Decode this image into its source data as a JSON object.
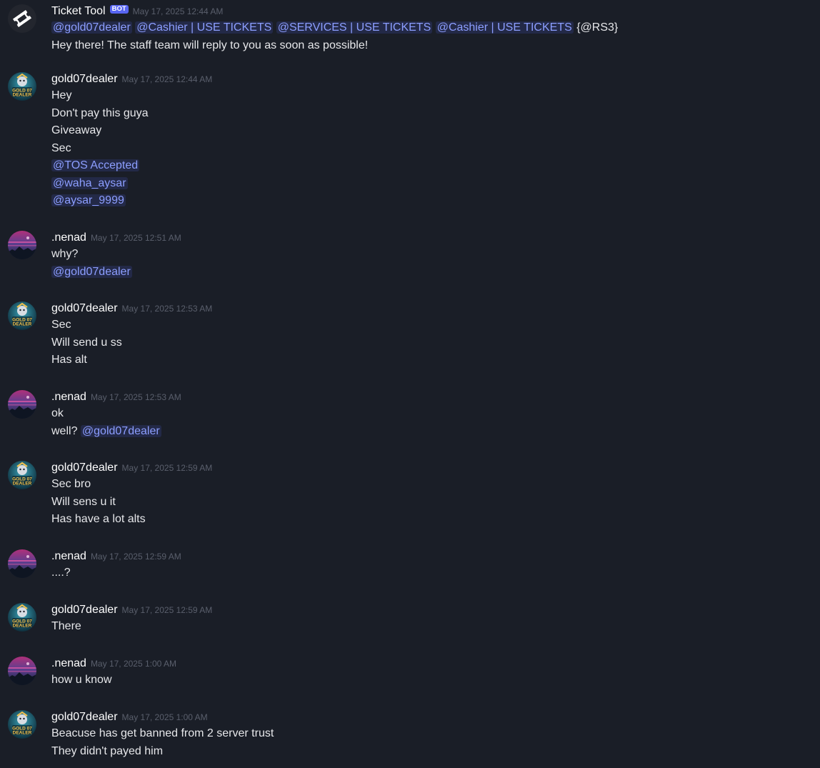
{
  "messages": [
    {
      "kind": "bot",
      "author": "Ticket Tool",
      "bot_tag": "BOT",
      "timestamp": "May 17, 2025 12:44 AM",
      "lines": [
        [
          {
            "type": "mention",
            "text": "@gold07dealer"
          },
          {
            "type": "text",
            "text": " "
          },
          {
            "type": "mention",
            "text": "@Cashier | USE TICKETS"
          },
          {
            "type": "text",
            "text": " "
          },
          {
            "type": "mention",
            "text": "@SERVICES | USE TICKETS"
          },
          {
            "type": "text",
            "text": " "
          },
          {
            "type": "mention",
            "text": "@Cashier | USE TICKETS"
          },
          {
            "type": "text",
            "text": " {@RS3}"
          }
        ],
        [
          {
            "type": "text",
            "text": "Hey there! The staff team will reply to you as soon as possible!"
          }
        ]
      ]
    },
    {
      "kind": "gold",
      "author": "gold07dealer",
      "timestamp": "May 17, 2025 12:44 AM",
      "lines": [
        [
          {
            "type": "text",
            "text": "Hey"
          }
        ],
        [
          {
            "type": "text",
            "text": "Don't pay this guya"
          }
        ],
        [
          {
            "type": "text",
            "text": "Giveaway"
          }
        ],
        [
          {
            "type": "text",
            "text": "Sec"
          }
        ],
        [
          {
            "type": "mention",
            "text": "@TOS Accepted"
          }
        ],
        [
          {
            "type": "mention",
            "text": "@waha_aysar"
          }
        ],
        [
          {
            "type": "mention",
            "text": "@aysar_9999"
          }
        ]
      ]
    },
    {
      "kind": "nenad",
      "author": ".nenad",
      "timestamp": "May 17, 2025 12:51 AM",
      "lines": [
        [
          {
            "type": "text",
            "text": "why?"
          }
        ],
        [
          {
            "type": "mention",
            "text": "@gold07dealer"
          }
        ]
      ]
    },
    {
      "kind": "gold",
      "author": "gold07dealer",
      "timestamp": "May 17, 2025 12:53 AM",
      "lines": [
        [
          {
            "type": "text",
            "text": "Sec"
          }
        ],
        [
          {
            "type": "text",
            "text": "Will send u ss"
          }
        ],
        [
          {
            "type": "text",
            "text": "Has alt"
          }
        ]
      ]
    },
    {
      "kind": "nenad",
      "author": ".nenad",
      "timestamp": "May 17, 2025 12:53 AM",
      "lines": [
        [
          {
            "type": "text",
            "text": "ok"
          }
        ],
        [
          {
            "type": "text",
            "text": "well? "
          },
          {
            "type": "mention",
            "text": "@gold07dealer"
          }
        ]
      ]
    },
    {
      "kind": "gold",
      "author": "gold07dealer",
      "timestamp": "May 17, 2025 12:59 AM",
      "lines": [
        [
          {
            "type": "text",
            "text": "Sec bro"
          }
        ],
        [
          {
            "type": "text",
            "text": "Will sens u it"
          }
        ],
        [
          {
            "type": "text",
            "text": "Has have a lot alts"
          }
        ]
      ]
    },
    {
      "kind": "nenad",
      "author": ".nenad",
      "timestamp": "May 17, 2025 12:59 AM",
      "lines": [
        [
          {
            "type": "text",
            "text": "....?"
          }
        ]
      ]
    },
    {
      "kind": "gold",
      "author": "gold07dealer",
      "timestamp": "May 17, 2025 12:59 AM",
      "lines": [
        [
          {
            "type": "text",
            "text": "There"
          }
        ]
      ]
    },
    {
      "kind": "nenad",
      "author": ".nenad",
      "timestamp": "May 17, 2025 1:00 AM",
      "lines": [
        [
          {
            "type": "text",
            "text": "how u know"
          }
        ]
      ]
    },
    {
      "kind": "gold",
      "author": "gold07dealer",
      "timestamp": "May 17, 2025 1:00 AM",
      "lines": [
        [
          {
            "type": "text",
            "text": "Beacuse has get banned from 2 server trust"
          }
        ],
        [
          {
            "type": "text",
            "text": "They didn't payed him"
          }
        ]
      ]
    }
  ],
  "avatars": {
    "bot": {
      "icon": "ticket-icon",
      "background": "#23262e"
    },
    "gold": {
      "icon": "gold07-dealer-avatar",
      "logo_text": [
        "GOLD 07",
        "DEALER"
      ],
      "background": "#1d5a6e"
    },
    "nenad": {
      "icon": "night-city-avatar",
      "background": "#3a2a55"
    }
  },
  "colors": {
    "background": "#1a1e27",
    "mention_text": "#8c9eff",
    "timestamp": "#5a5f6c",
    "bot_tag": "#5865f2"
  }
}
